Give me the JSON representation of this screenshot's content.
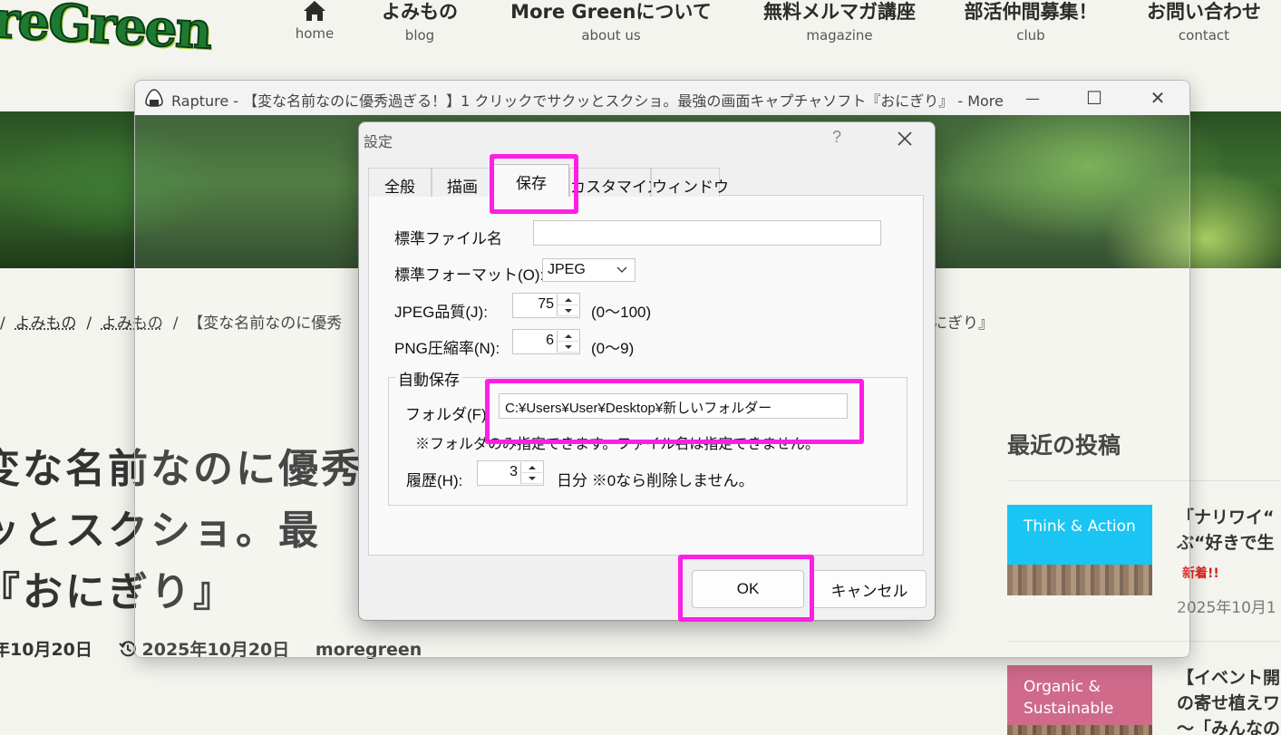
{
  "site": {
    "logo_text": "reGreen",
    "nav": [
      {
        "main": "",
        "sub": "home",
        "icon": "home-icon"
      },
      {
        "main": "よみもの",
        "sub": "blog"
      },
      {
        "main": "More Greenについて",
        "sub": "about us"
      },
      {
        "main": "無料メルマガ講座",
        "sub": "magazine"
      },
      {
        "main": "部活仲間募集！",
        "sub": "club"
      },
      {
        "main": "お問い合わせ",
        "sub": "contact"
      }
    ],
    "breadcrumb": {
      "sep": "/",
      "item1": "よみもの",
      "item2": "よみもの",
      "current": "【変な名前なのに優秀",
      "tail": "にぎり』"
    },
    "article": {
      "title_line1": "変な名前なのに優秀",
      "title_line2": "ッとスクショ。最",
      "title_line3": "『おにぎり』",
      "published": "年10月20日",
      "updated": "2025年10月20日",
      "author": "moregreen"
    },
    "sidebar": {
      "title": "最近の投稿",
      "posts": [
        {
          "category": "Think & Action",
          "category_color": "#00bff3",
          "title_line1": "「ナリワイ“",
          "title_line2": "ぶ“好きで生",
          "badge": "新着!!",
          "date": "2025年10月1"
        },
        {
          "category": "Organic & Sustainable",
          "category_color": "#cf6a8b",
          "title_line1": "【イベント開",
          "title_line2": "の寄せ植えワ",
          "title_line3": "～「みんなの"
        }
      ]
    }
  },
  "window": {
    "title": "Rapture - 【変な名前なのに優秀過ぎる！】1 クリックでサクッとスクショ。最強の画面キャプチャソフト『おにぎり』 - More Green -...",
    "minimize_symbol": "—",
    "maximize_symbol": "☐",
    "close_symbol": "✕"
  },
  "dialog": {
    "title": "設定",
    "help": "?",
    "tabs": [
      "全般",
      "描画",
      "保存",
      "カスタマイズ",
      "ウィンドウ"
    ],
    "active_tab": "保存",
    "fields": {
      "filename_label": "標準ファイル名",
      "filename_value": "",
      "format_label": "標準フォーマット(O):",
      "format_value": "JPEG",
      "jpeg_label": "JPEG品質(J):",
      "jpeg_value": "75",
      "jpeg_range": "(0〜100)",
      "png_label": "PNG圧縮率(N):",
      "png_value": "6",
      "png_range": "(0〜9)"
    },
    "autosave": {
      "legend": "自動保存",
      "folder_label": "フォルダ(F):",
      "folder_value": "C:¥Users¥User¥Desktop¥新しいフォルダー",
      "note": "※フォルダのみ指定できます。ファイル名は指定できません。",
      "history_label": "履歴(H):",
      "history_value": "3",
      "history_suffix": "日分 ※0なら削除しません。"
    },
    "ok_label": "OK",
    "cancel_label": "キャンセル"
  },
  "colors": {
    "highlight": "#ff1ee5",
    "site_bg": "#f4f4ef",
    "logo_green": "#1e7a30"
  }
}
